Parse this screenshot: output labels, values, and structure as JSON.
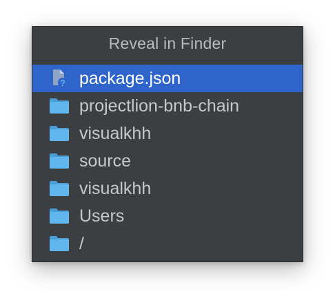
{
  "popup": {
    "title": "Reveal in Finder",
    "items": [
      {
        "label": "package.json",
        "icon": "unknown-file-icon",
        "selected": true
      },
      {
        "label": "projectlion-bnb-chain",
        "icon": "folder-icon",
        "selected": false
      },
      {
        "label": "visualkhh",
        "icon": "folder-icon",
        "selected": false
      },
      {
        "label": "source",
        "icon": "folder-icon",
        "selected": false
      },
      {
        "label": "visualkhh",
        "icon": "folder-icon",
        "selected": false
      },
      {
        "label": "Users",
        "icon": "folder-icon",
        "selected": false
      },
      {
        "label": "/",
        "icon": "folder-icon",
        "selected": false
      }
    ]
  },
  "colors": {
    "background": "#3c3f41",
    "selection": "#2f65ca",
    "folder": "#5fb4ea",
    "text": "#c8c8c8"
  }
}
